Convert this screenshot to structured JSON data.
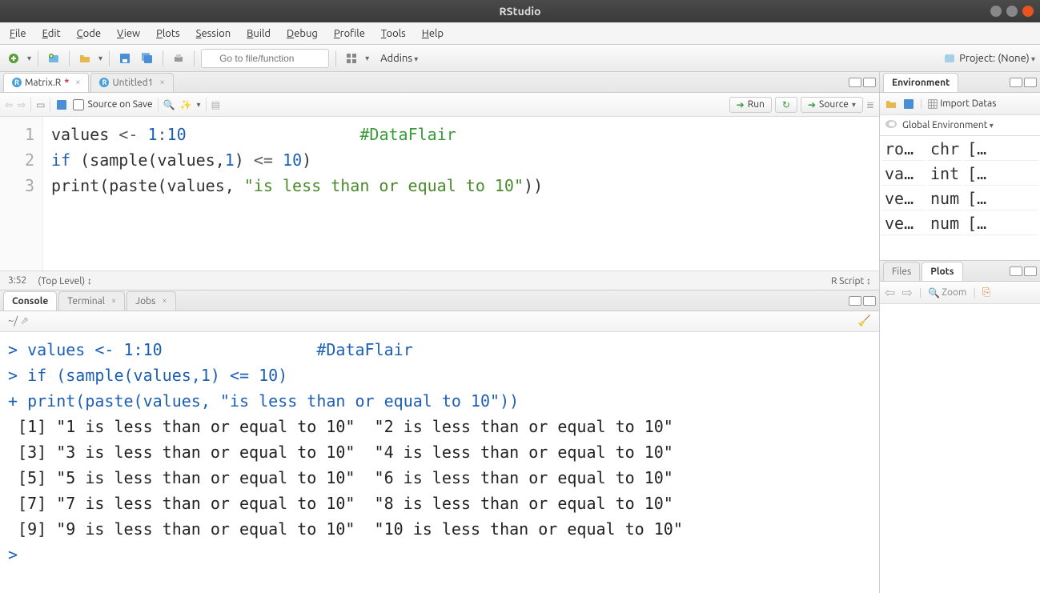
{
  "window": {
    "title": "RStudio"
  },
  "menu": [
    "File",
    "Edit",
    "Code",
    "View",
    "Plots",
    "Session",
    "Build",
    "Debug",
    "Profile",
    "Tools",
    "Help"
  ],
  "toolbar": {
    "goto_placeholder": "Go to file/function",
    "addins": "Addins",
    "project": "Project: (None)"
  },
  "source": {
    "tabs": [
      {
        "icon": "R",
        "label": "Matrix.R",
        "dirty": true,
        "active": true
      },
      {
        "icon": "R",
        "label": "Untitled1",
        "dirty": false,
        "active": false
      }
    ],
    "source_on_save": "Source on Save",
    "run_btn": "Run",
    "source_btn": "Source",
    "lines": [
      {
        "n": "1",
        "html": "values <span class='tk-op'>&lt;-</span> <span class='tk-num'>1</span><span class='tk-op'>:</span><span class='tk-num'>10</span>                  <span class='tk-cm'>#DataFlair</span>"
      },
      {
        "n": "2",
        "html": "<span class='tk-kw'>if</span> (sample(values,<span class='tk-num'>1</span>) <span class='tk-op'>&lt;=</span> <span class='tk-num'>10</span>)"
      },
      {
        "n": "3",
        "html": "print(paste(values, <span class='tk-str'>\"is less than or equal to 10\"</span>))"
      }
    ],
    "status_pos": "3:52",
    "status_scope": "(Top Level)",
    "status_type": "R Script"
  },
  "console": {
    "tabs": [
      "Console",
      "Terminal",
      "Jobs"
    ],
    "path": "~/",
    "lines": [
      {
        "p": ">",
        "t": " values <- 1:10                #DataFlair",
        "cls": "cons-prompt"
      },
      {
        "p": ">",
        "t": " if (sample(values,1) <= 10)",
        "cls": "cons-prompt"
      },
      {
        "p": "+",
        "t": " print(paste(values, \"is less than or equal to 10\"))",
        "cls": "cons-prompt"
      },
      {
        "p": "",
        "t": " [1] \"1 is less than or equal to 10\"  \"2 is less than or equal to 10\" ",
        "cls": "cons-plain"
      },
      {
        "p": "",
        "t": " [3] \"3 is less than or equal to 10\"  \"4 is less than or equal to 10\" ",
        "cls": "cons-plain"
      },
      {
        "p": "",
        "t": " [5] \"5 is less than or equal to 10\"  \"6 is less than or equal to 10\" ",
        "cls": "cons-plain"
      },
      {
        "p": "",
        "t": " [7] \"7 is less than or equal to 10\"  \"8 is less than or equal to 10\" ",
        "cls": "cons-plain"
      },
      {
        "p": "",
        "t": " [9] \"9 is less than or equal to 10\"  \"10 is less than or equal to 10\"",
        "cls": "cons-plain"
      },
      {
        "p": ">",
        "t": " ",
        "cls": "cons-prompt"
      }
    ]
  },
  "environment": {
    "tab": "Environment",
    "import": "Import Datas",
    "scope": "Global Environment",
    "rows": [
      {
        "name": "ro…",
        "type": "chr",
        "val": "[…"
      },
      {
        "name": "va…",
        "type": "int",
        "val": "[…"
      },
      {
        "name": "ve…",
        "type": "num",
        "val": "[…"
      },
      {
        "name": "ve…",
        "type": "num",
        "val": "[…"
      }
    ]
  },
  "plots": {
    "tabs": [
      "Files",
      "Plots"
    ],
    "zoom": "Zoom"
  }
}
